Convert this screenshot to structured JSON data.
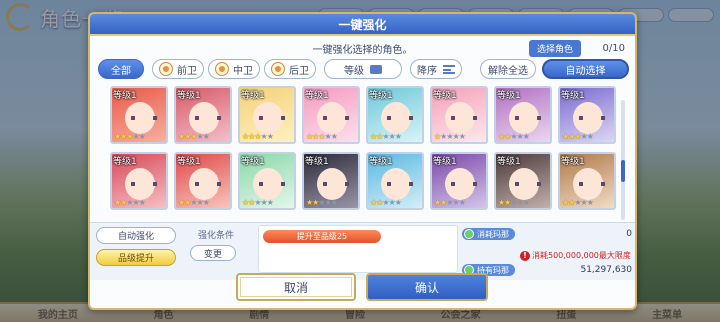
{
  "background": {
    "title": "角色一览",
    "nav": [
      "我的主页",
      "角色",
      "剧情",
      "冒险",
      "公会之家",
      "扭蛋",
      "主菜单"
    ]
  },
  "modal": {
    "title": "一键强化",
    "description": "一键强化选择的角色。",
    "selected_label": "选择角色",
    "selected_value": "0/10",
    "filters": {
      "all": "全部",
      "front": "前卫",
      "middle": "中卫",
      "back": "后卫",
      "level_dropdown": "等级",
      "sort_order": "降序",
      "deselect_all": "解除全选",
      "auto_select": "自动选择"
    },
    "characters_row1": [
      {
        "level": "等级1",
        "stars": 3
      },
      {
        "level": "等级1",
        "stars": 3
      },
      {
        "level": "等级1",
        "stars": 3
      },
      {
        "level": "等级1",
        "stars": 3
      },
      {
        "level": "等级1",
        "stars": 2
      },
      {
        "level": "等级1",
        "stars": 1
      },
      {
        "level": "等级1",
        "stars": 2
      },
      {
        "level": "等级1",
        "stars": 3
      }
    ],
    "characters_row2": [
      {
        "level": "等级1",
        "stars": 2
      },
      {
        "level": "等级1",
        "stars": 2
      },
      {
        "level": "等级1",
        "stars": 2
      },
      {
        "level": "等级1",
        "stars": 2
      },
      {
        "level": "等级1",
        "stars": 2
      },
      {
        "level": "等级1",
        "stars": 2
      },
      {
        "level": "等级1",
        "stars": 2
      },
      {
        "level": "等级1",
        "stars": 2
      }
    ],
    "left_buttons": {
      "auto_enhance": "自动强化",
      "rank_up": "品级提升"
    },
    "condition": {
      "label": "强化条件",
      "change": "变更",
      "tag": "提升至品级25"
    },
    "costs": {
      "consume_label": "消耗玛那",
      "consume_value": "0",
      "warning": "消耗500,000,000最大限度",
      "hold_label": "持有玛那",
      "hold_value": "51,297,630"
    },
    "cancel": "取消",
    "confirm": "确认"
  },
  "colors": {
    "accent": "#3a67c8",
    "gold": "#d4b66c",
    "warning": "#d02020"
  }
}
